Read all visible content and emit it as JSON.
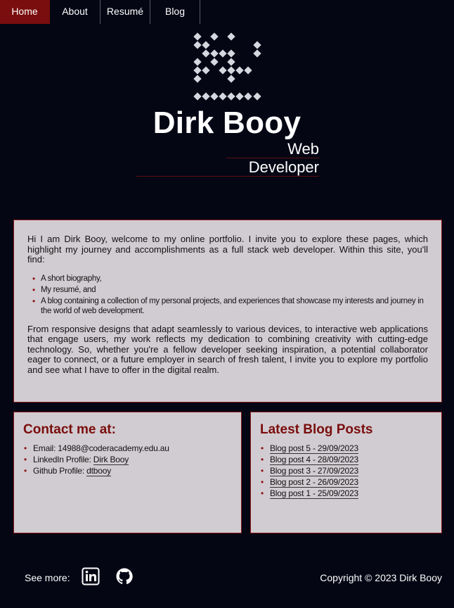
{
  "nav": {
    "items": [
      {
        "label": "Home",
        "active": true
      },
      {
        "label": "About"
      },
      {
        "label": "Resumé"
      },
      {
        "label": "Blog"
      }
    ]
  },
  "header": {
    "name": "Dirk Booy",
    "role_line1": "Web",
    "role_line2": "Developer"
  },
  "intro": {
    "paragraph1": "Hi I am Dirk Booy, welcome to my online portfolio. I invite you to explore these pages, which highlight my journey and accomplishments as a full stack web developer. Within this site, you'll find:",
    "list": [
      "A short biography,",
      "My resumé, and",
      "A blog containing a collection of my personal projects, and experiences that showcase my interests and journey in the world of web development."
    ],
    "paragraph2": "From responsive designs that adapt seamlessly to various devices, to interactive web applications that engage users, my work reflects my dedication to combining creativity with cutting-edge technology. So, whether you're a fellow developer seeking inspiration, a potential collaborator eager to connect, or a future employer in search of fresh talent, I invite you to explore my portfolio and see what I have to offer in the digital realm."
  },
  "contact": {
    "title": "Contact me at:",
    "email_label": "Email: ",
    "email": "14988@coderacademy.edu.au",
    "linkedin_label": "LinkedIn Profile: ",
    "linkedin_link": "Dirk Booy",
    "github_label": "Github Profile: ",
    "github_link": "dtbooy"
  },
  "blog": {
    "title": "Latest Blog Posts",
    "posts": [
      "Blog post 5 - 29/09/2023",
      "Blog post 4 - 28/09/2023",
      "Blog post 3 - 27/09/2023",
      "Blog post 2 - 26/09/2023",
      "Blog post 1 - 25/09/2023"
    ]
  },
  "footer": {
    "see_more": "See more:",
    "icons": [
      "linkedin-icon",
      "github-icon"
    ],
    "copyright": "Copyright © 2023 Dirk Booy"
  },
  "colors": {
    "background": "#040614",
    "accent": "#7a0d0d",
    "panel": "#d1ccd1"
  }
}
